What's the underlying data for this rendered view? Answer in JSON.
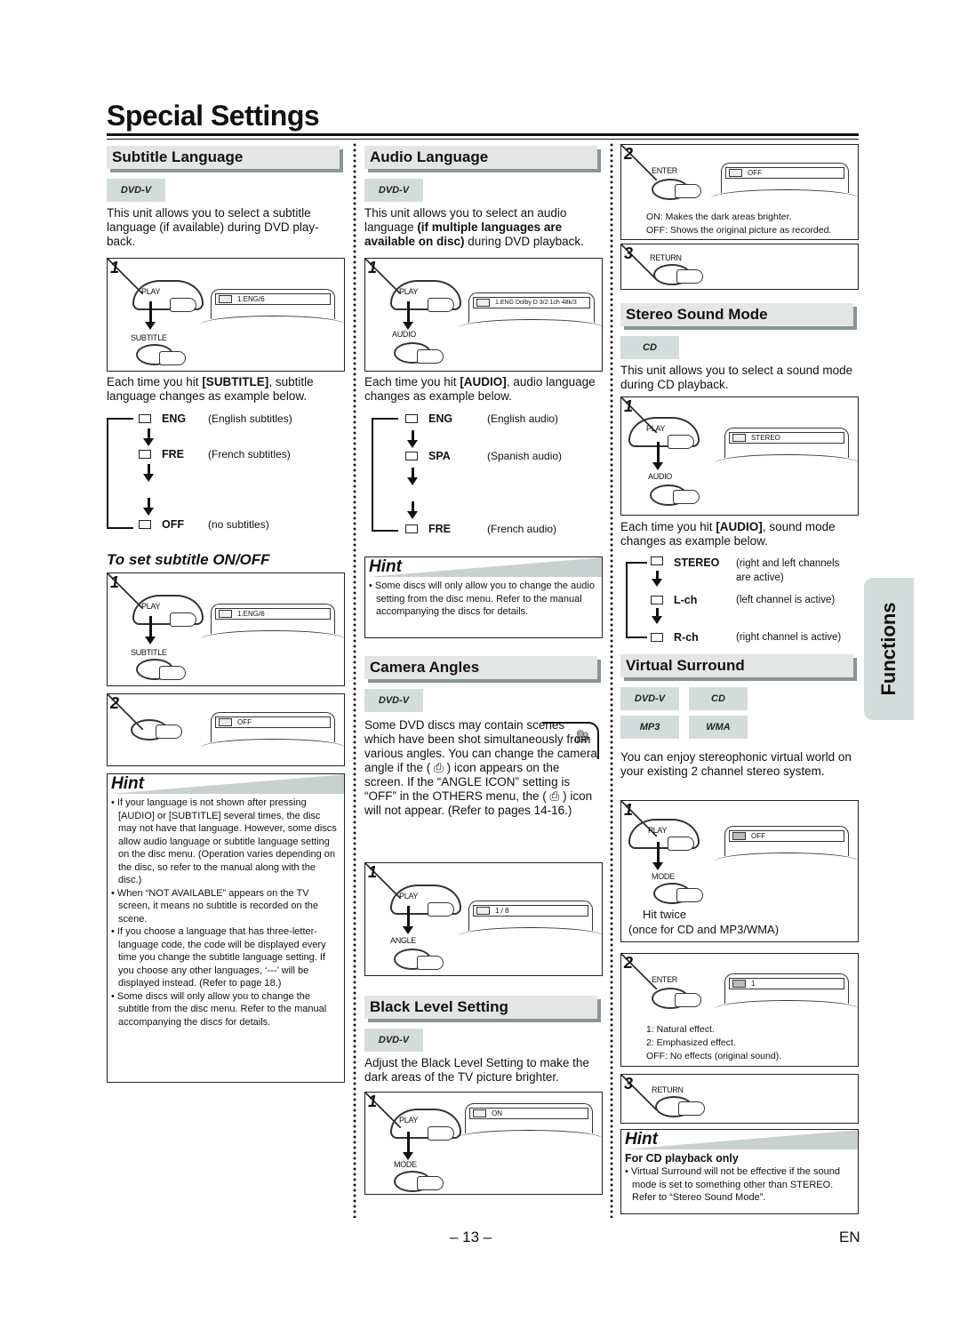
{
  "page": {
    "title": "Special Settings",
    "page_number": "– 13 –",
    "language": "EN",
    "side_tab": "Functions"
  },
  "subtitle_language": {
    "heading": "Subtitle Language",
    "badge": "DVD-V",
    "intro": "This unit allows you to select a subtitle language (if available) during DVD play-back.",
    "step1": {
      "number": "1",
      "play_label": "PLAY",
      "button_label": "SUBTITLE",
      "screen": "1.ENG/6"
    },
    "instruction_pre": "Each time you hit ",
    "instruction_key": "[SUBTITLE]",
    "instruction_post": ", subtitle language changes as example below.",
    "sequence": [
      {
        "code": "ENG",
        "desc": "(English subtitles)"
      },
      {
        "code": "FRE",
        "desc": "(French subtitles)"
      },
      {
        "code": "OFF",
        "desc": "(no subtitles)"
      }
    ],
    "onoff_heading": "To set subtitle ON/OFF",
    "onoff_step1": {
      "number": "1",
      "play_label": "PLAY",
      "button_label": "SUBTITLE",
      "screen": "1.ENG/6"
    },
    "onoff_step2": {
      "number": "2",
      "screen": "OFF"
    },
    "hint": {
      "title": "Hint",
      "items": [
        "If your language is not shown after pressing [AUDIO] or [SUBTITLE] several times, the disc may not have that language. However, some discs allow audio language or subtitle language setting on the disc menu. (Operation varies depending on the disc, so refer to the manual along with the disc.)",
        "When “NOT AVAILABLE” appears on the TV screen, it means no subtitle is recorded on the scene.",
        "If you choose a language that has three-letter-language code, the code will be displayed every time you change the subtitle language setting. If you choose any other languages, ‘---’ will be displayed instead. (Refer to page 18.)",
        "Some discs will only allow you to change the subtitle from the disc menu. Refer to the manual accompanying the discs for details."
      ]
    }
  },
  "audio_language": {
    "heading": "Audio Language",
    "badge": "DVD-V",
    "intro_pre": "This unit allows you to select an audio language ",
    "intro_bold": "(if multiple languages are available on disc)",
    "intro_post": " during DVD playback.",
    "step1": {
      "number": "1",
      "play_label": "PLAY",
      "button_label": "AUDIO",
      "screen": "1.ENG  Dolby D  3/2.1ch  48k/3"
    },
    "instruction_pre": "Each time you hit ",
    "instruction_key": "[AUDIO]",
    "instruction_post": ", audio language changes as example below.",
    "sequence": [
      {
        "code": "ENG",
        "desc": "(English audio)"
      },
      {
        "code": "SPA",
        "desc": "(Spanish audio)"
      },
      {
        "code": "FRE",
        "desc": "(French audio)"
      }
    ],
    "hint": {
      "title": "Hint",
      "items": [
        "Some discs will only allow you to change the audio setting from the disc menu. Refer to the manual accompanying the discs for details."
      ]
    }
  },
  "camera_angles": {
    "heading": "Camera Angles",
    "badge": "DVD-V",
    "text": "Some DVD discs may contain scenes which have been shot simultaneously from various angles. You can change the camera angle if the ( ⎙ ) icon appears on the screen. If the “ANGLE ICON” setting is “OFF” in the OTHERS menu, the ( ⎙ ) icon will not appear. (Refer to pages 14-16.)",
    "step1": {
      "number": "1",
      "play_label": "PLAY",
      "button_label": "ANGLE",
      "screen": "1 / 8"
    }
  },
  "black_level": {
    "heading": "Black Level Setting",
    "badge": "DVD-V",
    "intro": "Adjust the Black Level Setting to make the dark areas of the TV picture brighter.",
    "step1": {
      "number": "1",
      "play_label": "PLAY",
      "button_label": "MODE",
      "screen": "ON"
    },
    "step2": {
      "number": "2",
      "button_label": "ENTER",
      "screen": "OFF",
      "notes": [
        "ON: Makes the dark areas brighter.",
        "OFF: Shows the original picture as recorded."
      ]
    },
    "step3": {
      "number": "3",
      "button_label": "RETURN"
    }
  },
  "stereo_sound": {
    "heading": "Stereo Sound Mode",
    "badge": "CD",
    "intro": "This unit allows you to select a sound mode during CD playback.",
    "step1": {
      "number": "1",
      "play_label": "PLAY",
      "button_label": "AUDIO",
      "screen": "STEREO"
    },
    "instruction_pre": "Each time you hit ",
    "instruction_key": "[AUDIO]",
    "instruction_post": ", sound mode changes as example below.",
    "sequence": [
      {
        "code": "STEREO",
        "desc": "(right and left channels are active)"
      },
      {
        "code": "L-ch",
        "desc": "(left channel is active)"
      },
      {
        "code": "R-ch",
        "desc": "(right channel is active)"
      }
    ]
  },
  "virtual_surround": {
    "heading": "Virtual Surround",
    "badges": [
      "DVD-V",
      "CD",
      "MP3",
      "WMA"
    ],
    "intro": "You can enjoy stereophonic virtual world on your existing 2 channel stereo system.",
    "step1": {
      "number": "1",
      "play_label": "PLAY",
      "button_label": "MODE",
      "screen": "OFF",
      "note1": "Hit twice",
      "note2": "(once for CD and MP3/WMA)"
    },
    "step2": {
      "number": "2",
      "button_label": "ENTER",
      "screen": "1",
      "notes": [
        "1: Natural effect.",
        "2: Emphasized effect.",
        "OFF: No effects (original sound)."
      ]
    },
    "step3": {
      "number": "3",
      "button_label": "RETURN"
    },
    "hint": {
      "title": "Hint",
      "subheading": "For CD playback only",
      "items": [
        "Virtual Surround will not be effective if the sound mode is set to something other than STEREO. Refer to “Stereo Sound Mode”."
      ]
    }
  }
}
